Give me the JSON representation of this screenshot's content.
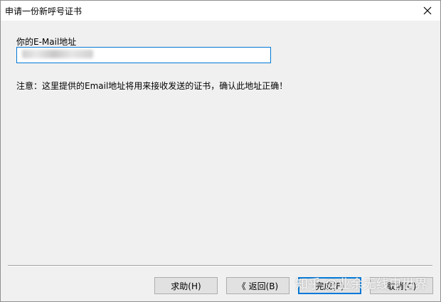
{
  "window": {
    "title": "申请一份新呼号证书"
  },
  "form": {
    "email_label": "你的E-Mail地址",
    "email_value": "",
    "note": "注意：这里提供的Email地址将用来接收发送的证书，确认此地址正确！"
  },
  "buttons": {
    "help": "求助(H)",
    "back": "《 返回(B)",
    "finish": "完成(F)",
    "cancel": "取消(C)"
  },
  "watermark": "知乎 @业余无线电世界",
  "colors": {
    "window_bg": "#f0f0f0",
    "focus_border": "#0078d7"
  },
  "icons": {
    "close": "close-icon"
  }
}
